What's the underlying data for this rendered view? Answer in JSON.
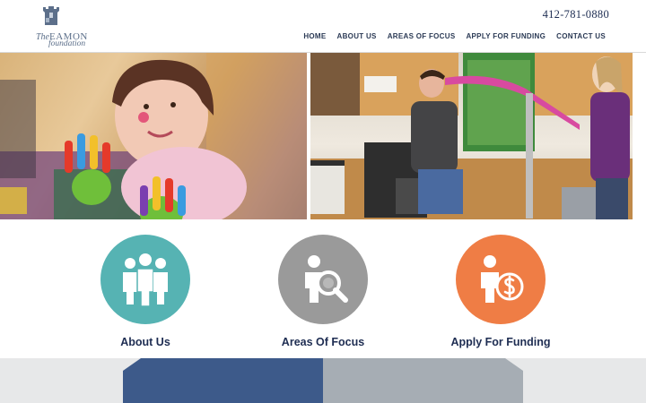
{
  "header": {
    "logo": {
      "line1": "The",
      "line2": "Eamon",
      "line3": "foundation"
    },
    "phone": "412-781-0880",
    "nav": [
      "HOME",
      "ABOUT US",
      "AREAS OF FOCUS",
      "APPLY FOR FUNDING",
      "CONTACT US"
    ]
  },
  "focus": [
    {
      "title": "About Us",
      "icon": "group-icon",
      "color": "#56b3b3"
    },
    {
      "title": "Areas Of Focus",
      "icon": "person-magnifier-icon",
      "color": "#9a9a9a"
    },
    {
      "title": "Apply For Funding",
      "icon": "person-dollar-icon",
      "color": "#ef7d45"
    }
  ],
  "colors": {
    "navy": "#1e2d52",
    "band_blue": "#3d5a8a",
    "band_gray": "#a6adb4"
  }
}
